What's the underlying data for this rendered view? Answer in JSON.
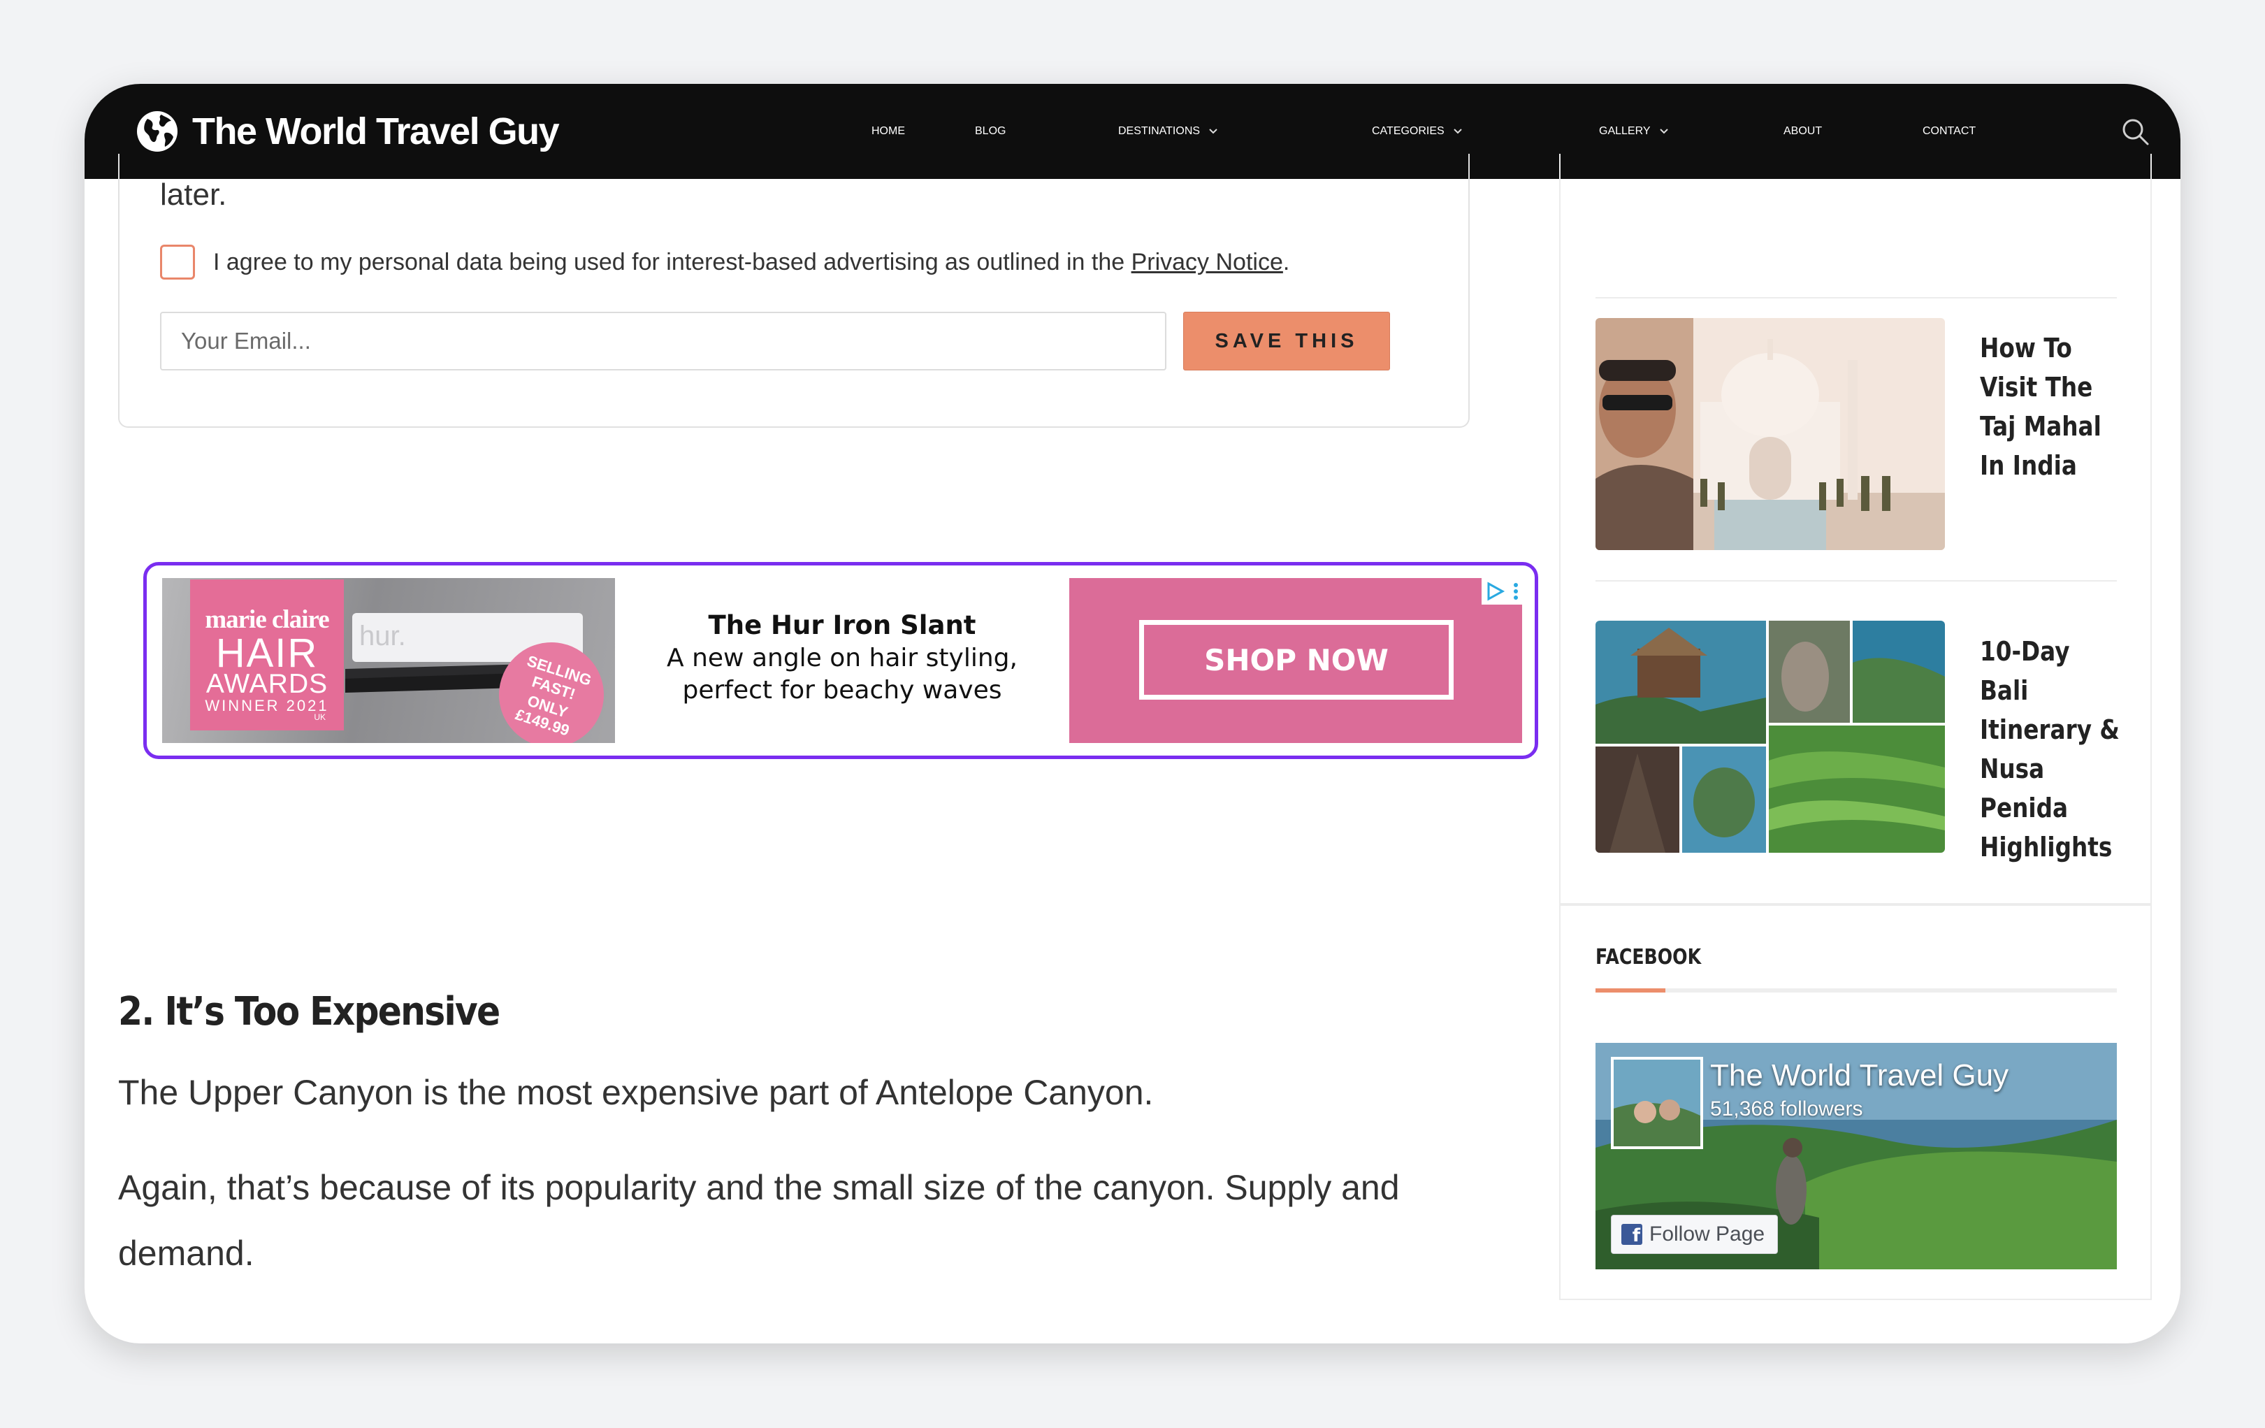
{
  "site": {
    "brand": "The World Travel Guy",
    "nav": [
      {
        "label": "HOME",
        "dropdown": false
      },
      {
        "label": "BLOG",
        "dropdown": false
      },
      {
        "label": "DESTINATIONS",
        "dropdown": true
      },
      {
        "label": "CATEGORIES",
        "dropdown": true
      },
      {
        "label": "GALLERY",
        "dropdown": true
      },
      {
        "label": "ABOUT",
        "dropdown": false
      },
      {
        "label": "CONTACT",
        "dropdown": false
      }
    ],
    "search_icon": "search-icon"
  },
  "subscribe": {
    "later_text": "later.",
    "consent_text": "I agree to my personal data being used for interest-based advertising as outlined in the ",
    "consent_link": "Privacy Notice",
    "consent_end": ".",
    "email_placeholder": "Your Email...",
    "save_label": "SAVE THIS"
  },
  "ad": {
    "badge_line1": "marie claire",
    "badge_line2": "HAIR",
    "badge_line3": "AWARDS",
    "badge_line4": "WINNER 2021",
    "badge_line5": "UK",
    "product_brand": "hur.",
    "sticker_line1": "SELLING",
    "sticker_line2": "FAST!",
    "sticker_line3": "ONLY",
    "sticker_line4": "£149.99",
    "title": "The Hur Iron Slant",
    "subtitle_line1": "A new angle on hair styling,",
    "subtitle_line2": "perfect for beachy waves",
    "cta": "SHOP NOW",
    "adchoices_icon": "adchoices-icon"
  },
  "article": {
    "heading": "2. It’s Too Expensive",
    "paragraphs": [
      "The Upper Canyon is the most expensive part of Antelope Canyon.",
      "Again, that’s because of its popularity and the small size of the canyon. Supply and demand."
    ]
  },
  "sidebar": {
    "posts": [
      {
        "title": "How To Visit The Taj Mahal In India"
      },
      {
        "title": "10-Day Bali Itinerary & Nusa Penida Highlights"
      }
    ],
    "facebook": {
      "heading": "FACEBOOK",
      "page_name": "The World Travel Guy",
      "followers": "51,368 followers",
      "follow_label": "Follow Page"
    }
  },
  "colors": {
    "accent": "#ec8e6b",
    "navbar": "#0e0e0e",
    "ad_border": "#7a2df0",
    "ad_pink": "#db6c98"
  }
}
